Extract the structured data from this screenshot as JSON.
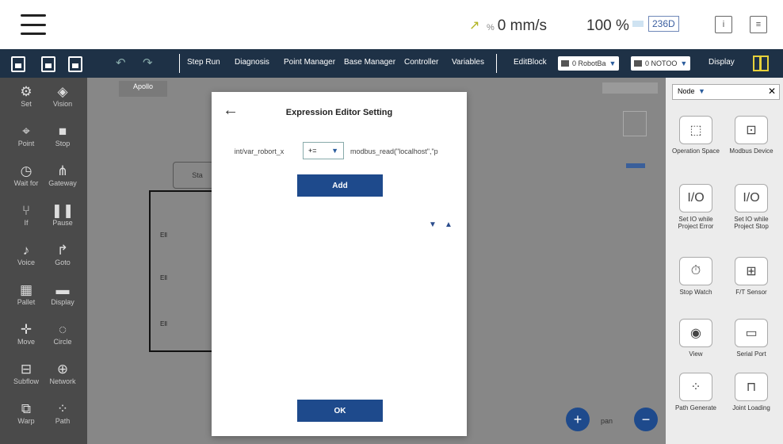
{
  "topbar": {
    "speed_value": "0 mm/s",
    "percent": "100 %",
    "badge": "236D"
  },
  "toolbar": {
    "items": [
      "Step Run",
      "Diagnosis",
      "Point Manager",
      "Base Manager",
      "Controller",
      "Variables"
    ],
    "editblock": "EditBlock",
    "robot_select": "0 RobotBa",
    "tool_select": "0 NOTOO",
    "display": "Display"
  },
  "leftpanel": {
    "items": [
      {
        "label": "Set",
        "icon": "set-icon"
      },
      {
        "label": "Vision",
        "icon": "vision-icon"
      },
      {
        "label": "Point",
        "icon": "point-icon"
      },
      {
        "label": "Stop",
        "icon": "stop-icon"
      },
      {
        "label": "Wait for",
        "icon": "wait-icon"
      },
      {
        "label": "Gateway",
        "icon": "gateway-icon"
      },
      {
        "label": "If",
        "icon": "if-icon"
      },
      {
        "label": "Pause",
        "icon": "pause-icon"
      },
      {
        "label": "Voice",
        "icon": "voice-icon"
      },
      {
        "label": "Goto",
        "icon": "goto-icon"
      },
      {
        "label": "Pallet",
        "icon": "pallet-icon"
      },
      {
        "label": "Display",
        "icon": "display-icon"
      },
      {
        "label": "Move",
        "icon": "move-icon"
      },
      {
        "label": "Circle",
        "icon": "circle-icon"
      },
      {
        "label": "Subflow",
        "icon": "subflow-icon"
      },
      {
        "label": "Network",
        "icon": "network-icon"
      },
      {
        "label": "Warp",
        "icon": "warp-icon"
      },
      {
        "label": "Path",
        "icon": "path-icon"
      }
    ]
  },
  "canvas": {
    "tab": "Apollo",
    "node_partial": "Sta",
    "rows": [
      "Ell",
      "Ell",
      "Ell"
    ]
  },
  "rightpanel": {
    "filter": "Node",
    "items": [
      {
        "label": "Operation Space",
        "icon": "operation-space-icon"
      },
      {
        "label": "Modbus Device",
        "icon": "modbus-device-icon"
      },
      {
        "label": "Set IO while Project Error",
        "icon": "io-error-icon"
      },
      {
        "label": "Set IO while Project Stop",
        "icon": "io-stop-icon"
      },
      {
        "label": "Stop Watch",
        "icon": "stopwatch-icon"
      },
      {
        "label": "F/T Sensor",
        "icon": "ft-sensor-icon"
      },
      {
        "label": "View",
        "icon": "view-icon"
      },
      {
        "label": "Serial Port",
        "icon": "serial-port-icon"
      },
      {
        "label": "Path Generate",
        "icon": "path-generate-icon"
      },
      {
        "label": "Joint Loading",
        "icon": "joint-loading-icon"
      }
    ]
  },
  "dialog": {
    "title": "Expression Editor Setting",
    "variable": "int/var_robort_x",
    "operator": "+=",
    "value": "modbus_read(\"localhost\",\"p",
    "add_label": "Add",
    "ok_label": "OK"
  },
  "zoom_label": "pan"
}
